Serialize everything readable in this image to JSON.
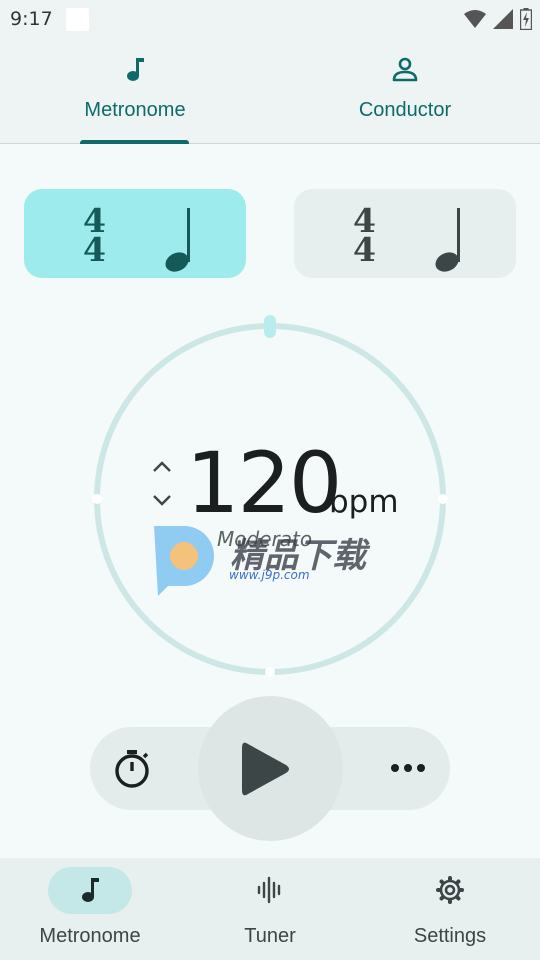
{
  "status_bar": {
    "time": "9:17"
  },
  "top_tabs": [
    {
      "label": "Metronome",
      "icon": "music-note-icon",
      "selected": true
    },
    {
      "label": "Conductor",
      "icon": "person-icon",
      "selected": false
    }
  ],
  "time_signatures": [
    {
      "numerator": "4",
      "denominator": "4",
      "note": "quarter-note-icon",
      "selected": true
    },
    {
      "numerator": "4",
      "denominator": "4",
      "note": "quarter-note-icon",
      "selected": false
    }
  ],
  "tempo": {
    "bpm": "120",
    "unit": "bpm",
    "name": "Moderato"
  },
  "watermark": {
    "brand": "精品下载",
    "url": "www.j9p.com"
  },
  "controls": {
    "timer_icon": "stopwatch-icon",
    "play_icon": "play-icon",
    "more_icon": "more-horiz-icon"
  },
  "bottom_nav": [
    {
      "label": "Metronome",
      "icon": "music-note-icon",
      "selected": true
    },
    {
      "label": "Tuner",
      "icon": "waveform-icon",
      "selected": false
    },
    {
      "label": "Settings",
      "icon": "gear-icon",
      "selected": false
    }
  ],
  "colors": {
    "accent": "#0f6b6a",
    "selected_card": "#9debec",
    "unselected_card": "#e7eeee",
    "ring": "#cde7e6",
    "background": "#f4fafa"
  }
}
